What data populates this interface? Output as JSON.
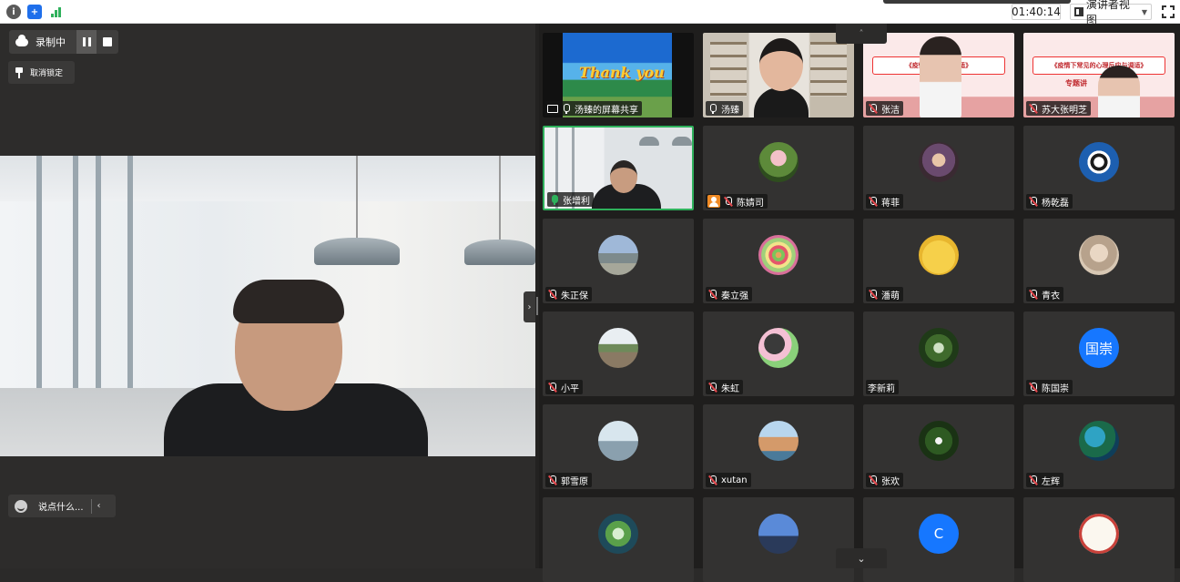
{
  "topbar": {
    "time": "01:40:14",
    "presenter_view_label": "演讲者视图"
  },
  "left_pane": {
    "recording_label": "录制中",
    "unlock_label": "取消锁定",
    "chat_placeholder": "说点什么...",
    "chat_collapse_glyph": "‹",
    "split_handle_glyph": "›"
  },
  "grid": {
    "scroll_up_glyph": "˄",
    "scroll_down_glyph": "⌄",
    "slide_title": "《疫情下常见的心理反应与调适》",
    "slide_title_partial": "《疫情下常",
    "slide_title_partial_end": "应与调适》",
    "slide_subtitle": "专题讲",
    "thank_you_text": "Thank you",
    "tiles": [
      {
        "name": "汤臻的屏幕共享",
        "mic": "on",
        "kind": "share"
      },
      {
        "name": "汤臻",
        "mic": "on",
        "kind": "video-woman"
      },
      {
        "name": "张洁",
        "mic": "muted",
        "kind": "slide"
      },
      {
        "name": "苏大张明芝",
        "mic": "muted",
        "kind": "slide2"
      },
      {
        "name": "张增利",
        "mic": "green",
        "kind": "video-man",
        "active": true
      },
      {
        "name": "陈婧司",
        "mic": "muted",
        "kind": "avatar",
        "badge": "person"
      },
      {
        "name": "蒋菲",
        "mic": "muted",
        "kind": "avatar"
      },
      {
        "name": "杨乾磊",
        "mic": "muted",
        "kind": "avatar"
      },
      {
        "name": "朱正保",
        "mic": "muted",
        "kind": "avatar"
      },
      {
        "name": "秦立强",
        "mic": "muted",
        "kind": "avatar"
      },
      {
        "name": "潘萌",
        "mic": "muted",
        "kind": "avatar"
      },
      {
        "name": "青衣",
        "mic": "muted",
        "kind": "avatar"
      },
      {
        "name": "小平",
        "mic": "muted",
        "kind": "avatar"
      },
      {
        "name": "朱虹",
        "mic": "muted",
        "kind": "avatar"
      },
      {
        "name": "李新莉",
        "mic": "none",
        "kind": "avatar"
      },
      {
        "name": "陈国崇",
        "mic": "muted",
        "kind": "text-avatar",
        "avatar_text": "国崇"
      },
      {
        "name": "郭雪原",
        "mic": "muted",
        "kind": "avatar"
      },
      {
        "name": "xutan",
        "mic": "muted",
        "kind": "avatar"
      },
      {
        "name": "张欢",
        "mic": "muted",
        "kind": "avatar"
      },
      {
        "name": "左辉",
        "mic": "muted",
        "kind": "avatar"
      },
      {
        "name": "",
        "mic": "none",
        "kind": "avatar"
      },
      {
        "name": "",
        "mic": "none",
        "kind": "avatar"
      },
      {
        "name": "",
        "mic": "none",
        "kind": "text-avatar",
        "avatar_text": "C"
      },
      {
        "name": "",
        "mic": "none",
        "kind": "avatar"
      }
    ]
  },
  "colors": {
    "active_border": "#2fb15c",
    "muted_slash": "#e5484d",
    "avatar_blue": "#1677ff",
    "slide_red": "#c0282d"
  }
}
